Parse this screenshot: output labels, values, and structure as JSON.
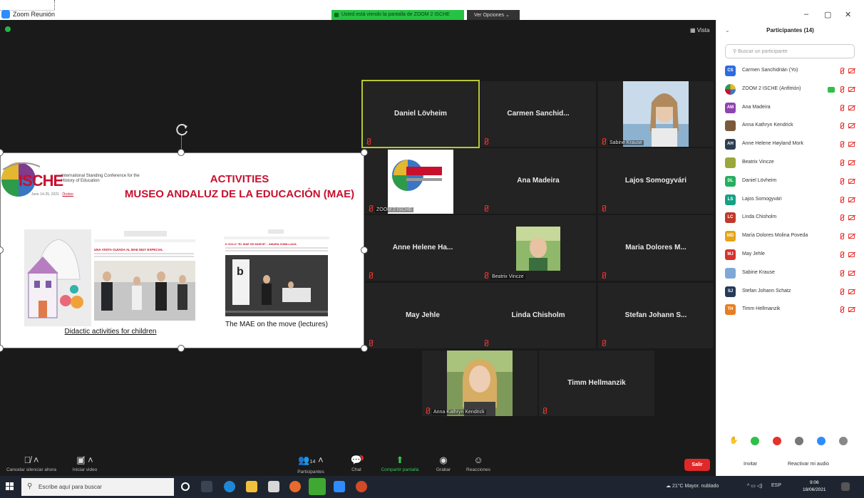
{
  "window": {
    "title": "Zoom Reunión",
    "share_banner": "Usted está viendo la pantalla de ZOOM 2 ISCHE",
    "view_options": "Ver Opciones ⌄",
    "minimize": "–",
    "maximize": "▢",
    "close": "✕"
  },
  "meeting": {
    "view_label": "Vista",
    "tiles": [
      {
        "name": "Daniel Lövheim",
        "label": ""
      },
      {
        "name": "Carmen Sanchid...",
        "label": ""
      },
      {
        "name": "",
        "label": "Sabine Krause"
      },
      {
        "name": "",
        "label": "ZOOM 2 ISCHE"
      },
      {
        "name": "Ana Madeira",
        "label": ""
      },
      {
        "name": "Lajos Somogyvári",
        "label": ""
      },
      {
        "name": "Anne Helene Ha...",
        "label": ""
      },
      {
        "name": "",
        "label": "Beatrix Vincze"
      },
      {
        "name": "Maria Dolores M...",
        "label": ""
      },
      {
        "name": "May Jehle",
        "label": ""
      },
      {
        "name": "Linda Chisholm",
        "label": ""
      },
      {
        "name": "Stefan Johann S...",
        "label": ""
      },
      {
        "name": "",
        "label": "Anna Kathryn Kendrick"
      },
      {
        "name": "Timm Hellmanzik",
        "label": ""
      }
    ]
  },
  "slide": {
    "logo_text": "ISCHE",
    "logo_subtitle": "International Standing Conference for the History of Education",
    "logo_date": "June 14-25, 2021 · ",
    "logo_city": "Örebro",
    "title_line1": "ACTIVITIES",
    "title_line2": "MUSEO ANDALUZ DE LA EDUCACIÓN (MAE)",
    "screenshot1_heading": "UNA VISITA GUIADA AL MAE MUY ESPECIAL",
    "screenshot2_heading": "II CICLO \"EL MAE SE MUEVE\" - AMARA ZUBILLAGA",
    "caption1": "Didactic activities for children",
    "caption2": "The MAE on the move (lectures)"
  },
  "toolbar": {
    "mute": "Cancelar silenciar ahora",
    "video": "Iniciar video",
    "participants": "Participantes",
    "participants_count": "14",
    "chat": "Chat",
    "share": "Compartir pantalla",
    "record": "Grabar",
    "reactions": "Reacciones",
    "leave": "Salir"
  },
  "panel": {
    "title": "Participantes (14)",
    "search_placeholder": "Buscar un participante",
    "invite": "Invitar",
    "unmute_me": "Reactivar mi audio",
    "participants": [
      {
        "initials": "CS",
        "name": "Carmen Sanchidrián (Yo)",
        "color": "#2d6cdf"
      },
      {
        "initials": "",
        "name": "ZOOM 2 ISCHE (Anfitrión)",
        "color": "#ffffff"
      },
      {
        "initials": "AM",
        "name": "Ana Madeira",
        "color": "#8e44ad"
      },
      {
        "initials": "",
        "name": "Anna Kathryn Kendrick",
        "color": "#7a5a3a"
      },
      {
        "initials": "AH",
        "name": "Anne Helene Høyland Mork",
        "color": "#2d3e50"
      },
      {
        "initials": "",
        "name": "Beatrix Vincze",
        "color": "#9aa83a"
      },
      {
        "initials": "DL",
        "name": "Daniel Lövheim",
        "color": "#27ae60"
      },
      {
        "initials": "LS",
        "name": "Lajos Somogyvári",
        "color": "#16a085"
      },
      {
        "initials": "LC",
        "name": "Linda Chisholm",
        "color": "#c0392b"
      },
      {
        "initials": "MD",
        "name": "María Dolores Molina Poveda",
        "color": "#e6a417"
      },
      {
        "initials": "MJ",
        "name": "May Jehle",
        "color": "#d4342c"
      },
      {
        "initials": "",
        "name": "Sabine Krause",
        "color": "#7fa8d6"
      },
      {
        "initials": "SJ",
        "name": "Stefan Johann Schatz",
        "color": "#263a5a"
      },
      {
        "initials": "TH",
        "name": "Timm Hellmanzik",
        "color": "#e67e22"
      }
    ]
  },
  "taskbar": {
    "search_placeholder": "Escribe aquí para buscar",
    "weather": "21°C  Mayor. nublado",
    "language": "ESP",
    "time": "9:06",
    "date": "18/06/2021"
  },
  "colors": {
    "accent_red": "#c8102e",
    "active_speaker_border": "#b7c832",
    "share_green": "#27c244",
    "leave_red": "#e02828"
  }
}
